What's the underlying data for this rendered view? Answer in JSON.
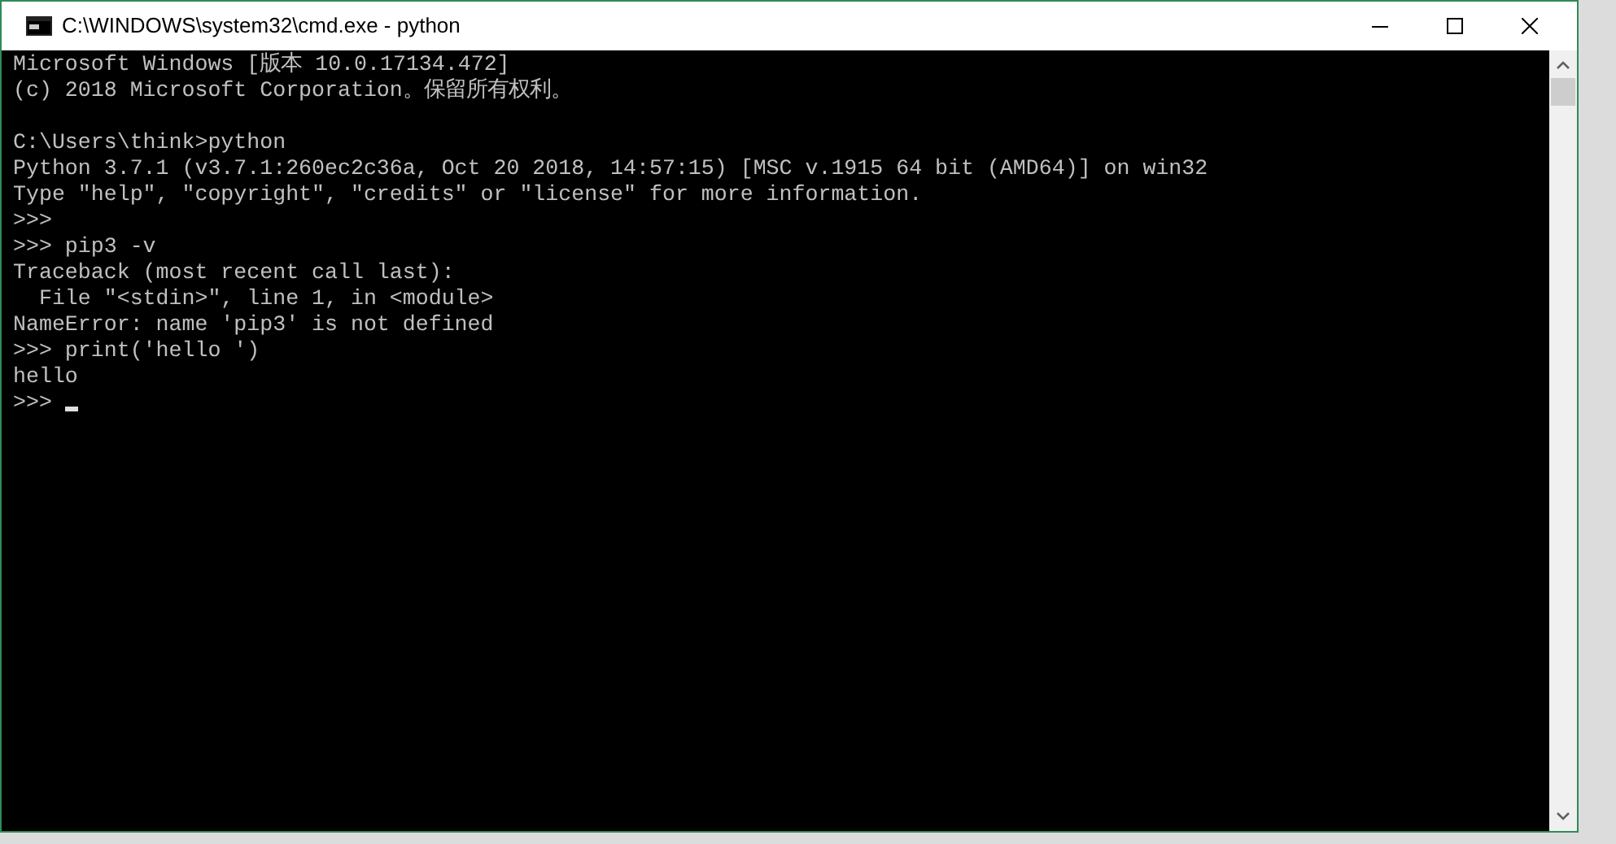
{
  "window": {
    "title": "C:\\WINDOWS\\system32\\cmd.exe - python"
  },
  "console": {
    "cursor": true,
    "blocks": [
      {
        "lines": [
          "Microsoft Windows [版本 10.0.17134.472]",
          "(c) 2018 Microsoft Corporation。保留所有权利。"
        ]
      },
      {
        "lines": [
          "C:\\Users\\think>python",
          "Python 3.7.1 (v3.7.1:260ec2c36a, Oct 20 2018, 14:57:15) [MSC v.1915 64 bit (AMD64)] on win32",
          "Type \"help\", \"copyright\", \"credits\" or \"license\" for more information.",
          ">>>",
          ">>> pip3 -v",
          "Traceback (most recent call last):",
          "  File \"<stdin>\", line 1, in <module>",
          "NameError: name 'pip3' is not defined",
          ">>> print('hello ')",
          "hello",
          ">>>"
        ]
      }
    ]
  }
}
